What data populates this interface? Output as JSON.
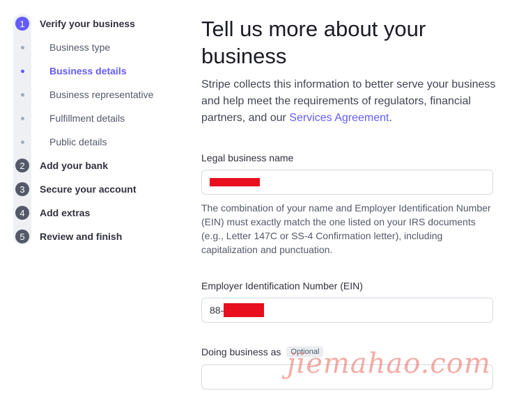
{
  "sidebar": {
    "steps": [
      {
        "number": "1",
        "label": "Verify your business",
        "state": "active"
      },
      {
        "number": "2",
        "label": "Add your bank"
      },
      {
        "number": "3",
        "label": "Secure your account"
      },
      {
        "number": "4",
        "label": "Add extras"
      },
      {
        "number": "5",
        "label": "Review and finish"
      }
    ],
    "substeps": [
      {
        "label": "Business type"
      },
      {
        "label": "Business details",
        "state": "active"
      },
      {
        "label": "Business representative"
      },
      {
        "label": "Fulfillment details"
      },
      {
        "label": "Public details"
      }
    ]
  },
  "main": {
    "title": "Tell us more about your business",
    "intro_text": "Stripe collects this information to better serve your business and help meet the requirements of regulators, financial partners, and our ",
    "intro_link": "Services Agreement",
    "intro_end": ".",
    "legal_name": {
      "label": "Legal business name",
      "help": "The combination of your name and Employer Identification Number (EIN) must exactly match the one listed on your IRS documents (e.g., Letter 147C or SS-4 Confirmation letter), including capitalization and punctuation."
    },
    "ein": {
      "label": "Employer Identification Number (EIN)",
      "value_prefix": "88-"
    },
    "dba": {
      "label": "Doing business as",
      "badge": "Optional"
    }
  },
  "watermark": "jiemahao.com",
  "colors": {
    "accent": "#635bff",
    "step_inactive": "#545969",
    "redaction": "#e8101e"
  }
}
